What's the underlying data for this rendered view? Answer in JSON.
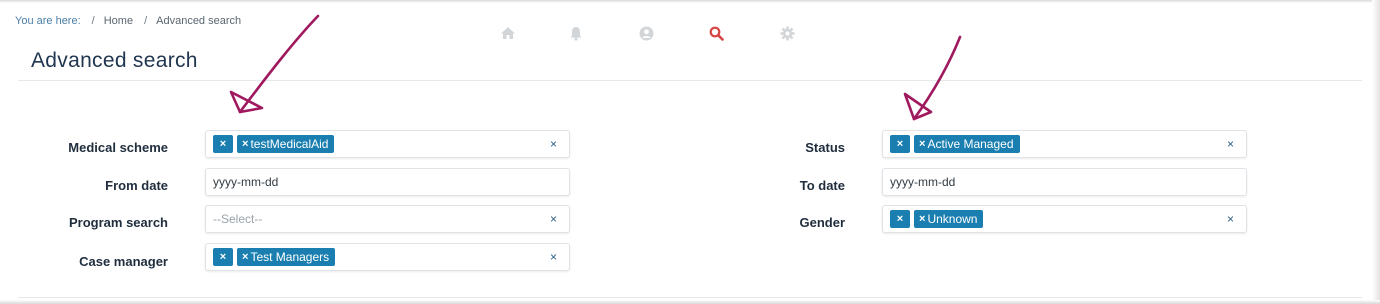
{
  "breadcrumb": {
    "label": "You are here:",
    "items": [
      "Home",
      "Advanced search"
    ]
  },
  "toolbar": {
    "icons": [
      "home-icon",
      "bell-icon",
      "user-circle-icon",
      "search-icon",
      "gear-icon"
    ],
    "active": "search-icon",
    "active_color": "#d64541",
    "inactive_color": "#d3d6d9"
  },
  "page": {
    "title": "Advanced search"
  },
  "form": {
    "medical_scheme": {
      "label": "Medical scheme",
      "tags": [
        "testMedicalAid"
      ],
      "clear": "×"
    },
    "from_date": {
      "label": "From date",
      "value": "yyyy-mm-dd"
    },
    "program_search": {
      "label": "Program search",
      "placeholder": "--Select--",
      "clear": "×"
    },
    "case_manager": {
      "label": "Case manager",
      "tags": [
        "Test Managers"
      ],
      "clear": "×"
    },
    "status": {
      "label": "Status",
      "tags": [
        "Active Managed"
      ],
      "clear": "×"
    },
    "to_date": {
      "label": "To date",
      "value": "yyyy-mm-dd"
    },
    "gender": {
      "label": "Gender",
      "tags": [
        "Unknown"
      ],
      "clear": "×"
    },
    "chip_remove": "×",
    "chip_color": "#1a7fb0"
  },
  "annotation": {
    "color": "#a0195e"
  }
}
